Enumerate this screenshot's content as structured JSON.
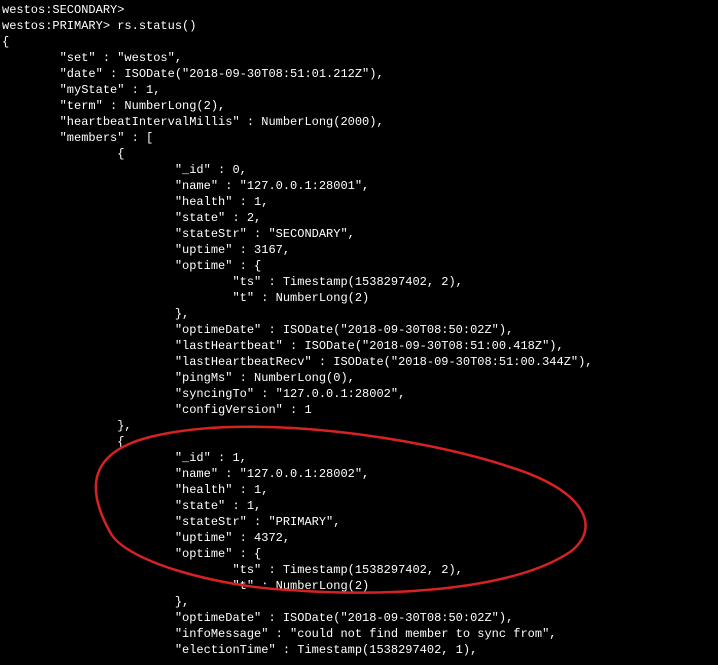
{
  "prompts": {
    "secondary_prompt": "westos:SECONDARY>",
    "primary_prompt": "westos:PRIMARY> rs.status()"
  },
  "lines": [
    "westos:SECONDARY>",
    "westos:PRIMARY> rs.status()",
    "{",
    "        \"set\" : \"westos\",",
    "        \"date\" : ISODate(\"2018-09-30T08:51:01.212Z\"),",
    "        \"myState\" : 1,",
    "        \"term\" : NumberLong(2),",
    "        \"heartbeatIntervalMillis\" : NumberLong(2000),",
    "        \"members\" : [",
    "                {",
    "                        \"_id\" : 0,",
    "                        \"name\" : \"127.0.0.1:28001\",",
    "                        \"health\" : 1,",
    "                        \"state\" : 2,",
    "                        \"stateStr\" : \"SECONDARY\",",
    "                        \"uptime\" : 3167,",
    "                        \"optime\" : {",
    "                                \"ts\" : Timestamp(1538297402, 2),",
    "                                \"t\" : NumberLong(2)",
    "                        },",
    "                        \"optimeDate\" : ISODate(\"2018-09-30T08:50:02Z\"),",
    "                        \"lastHeartbeat\" : ISODate(\"2018-09-30T08:51:00.418Z\"),",
    "                        \"lastHeartbeatRecv\" : ISODate(\"2018-09-30T08:51:00.344Z\"),",
    "                        \"pingMs\" : NumberLong(0),",
    "                        \"syncingTo\" : \"127.0.0.1:28002\",",
    "                        \"configVersion\" : 1",
    "                },",
    "                {",
    "                        \"_id\" : 1,",
    "                        \"name\" : \"127.0.0.1:28002\",",
    "                        \"health\" : 1,",
    "                        \"state\" : 1,",
    "                        \"stateStr\" : \"PRIMARY\",",
    "                        \"uptime\" : 4372,",
    "                        \"optime\" : {",
    "                                \"ts\" : Timestamp(1538297402, 2),",
    "                                \"t\" : NumberLong(2)",
    "                        },",
    "                        \"optimeDate\" : ISODate(\"2018-09-30T08:50:02Z\"),",
    "                        \"infoMessage\" : \"could not find member to sync from\",",
    "                        \"electionTime\" : Timestamp(1538297402, 1),"
  ],
  "status": {
    "set": "westos",
    "date": "ISODate(\"2018-09-30T08:51:01.212Z\")",
    "myState": 1,
    "term": "NumberLong(2)",
    "heartbeatIntervalMillis": "NumberLong(2000)",
    "members": [
      {
        "_id": 0,
        "name": "127.0.0.1:28001",
        "health": 1,
        "state": 2,
        "stateStr": "SECONDARY",
        "uptime": 3167,
        "optime": {
          "ts": "Timestamp(1538297402, 2)",
          "t": "NumberLong(2)"
        },
        "optimeDate": "ISODate(\"2018-09-30T08:50:02Z\")",
        "lastHeartbeat": "ISODate(\"2018-09-30T08:51:00.418Z\")",
        "lastHeartbeatRecv": "ISODate(\"2018-09-30T08:51:00.344Z\")",
        "pingMs": "NumberLong(0)",
        "syncingTo": "127.0.0.1:28002",
        "configVersion": 1
      },
      {
        "_id": 1,
        "name": "127.0.0.1:28002",
        "health": 1,
        "state": 1,
        "stateStr": "PRIMARY",
        "uptime": 4372,
        "optime": {
          "ts": "Timestamp(1538297402, 2)",
          "t": "NumberLong(2)"
        },
        "optimeDate": "ISODate(\"2018-09-30T08:50:02Z\")",
        "infoMessage": "could not find member to sync from",
        "electionTime": "Timestamp(1538297402, 1)"
      }
    ]
  },
  "annotation": {
    "color": "#d62222",
    "stroke_width": 2.5
  }
}
